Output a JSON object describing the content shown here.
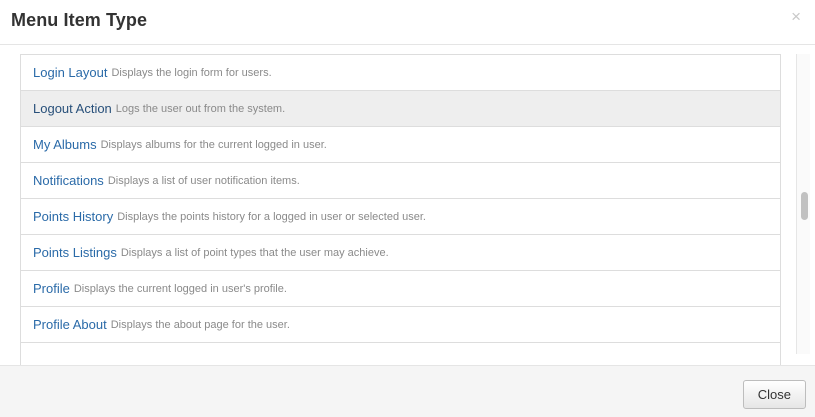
{
  "modal": {
    "title": "Menu Item Type",
    "close_icon": "×",
    "close_button_label": "Close"
  },
  "items": [
    {
      "title": "Login Layout",
      "description": "Displays the login form for users.",
      "active": false
    },
    {
      "title": "Logout Action",
      "description": "Logs the user out from the system.",
      "active": true
    },
    {
      "title": "My Albums",
      "description": "Displays albums for the current logged in user.",
      "active": false
    },
    {
      "title": "Notifications",
      "description": "Displays a list of user notification items.",
      "active": false
    },
    {
      "title": "Points History",
      "description": "Displays the points history for a logged in user or selected user.",
      "active": false
    },
    {
      "title": "Points Listings",
      "description": "Displays a list of point types that the user may achieve.",
      "active": false
    },
    {
      "title": "Profile",
      "description": "Displays the current logged in user's profile.",
      "active": false
    },
    {
      "title": "Profile About",
      "description": "Displays the about page for the user.",
      "active": false
    },
    {
      "title": "",
      "description": "",
      "active": false
    }
  ],
  "colors": {
    "link": "#2a6aa8",
    "active_background": "#eeeeee",
    "description": "#8a8a8a"
  },
  "icons": {
    "close": "close-icon"
  }
}
